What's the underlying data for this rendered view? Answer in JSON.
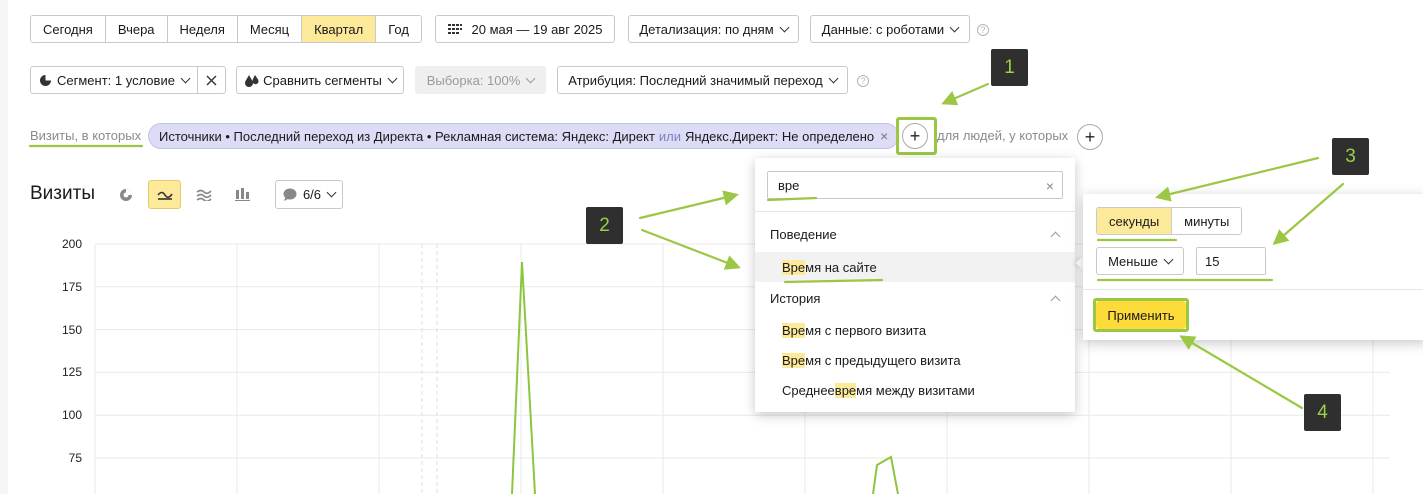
{
  "period": {
    "tabs": [
      {
        "label": "Сегодня",
        "active": false
      },
      {
        "label": "Вчера",
        "active": false
      },
      {
        "label": "Неделя",
        "active": false
      },
      {
        "label": "Месяц",
        "active": false
      },
      {
        "label": "Квартал",
        "active": true
      },
      {
        "label": "Год",
        "active": false
      }
    ],
    "date_range": "20 мая — 19 авг 2025"
  },
  "toolbar": {
    "detail_label": "Детализация: по дням",
    "data_label": "Данные: с роботами",
    "help_glyph": "?",
    "segment_label": "Сегмент: 1 условие",
    "compare_label": "Сравнить сегменты",
    "sample_label": "Выборка: 100%",
    "attribution_label": "Атрибуция: Последний значимый переход"
  },
  "filters": {
    "visits_label": "Визиты, в которых",
    "chip_part1": "Источники • Последний переход из Директа • Рекламная система: Яндекс: Директ",
    "chip_or": "или",
    "chip_part2": "Яндекс.Директ: Не определено",
    "people_label": "для людей, у которых",
    "plus_glyph": "+"
  },
  "chart": {
    "title": "Визиты",
    "series_selector": "6/6",
    "line_color": "#8cc63f"
  },
  "chart_data": {
    "type": "line",
    "y_ticks": [
      200,
      175,
      150,
      125,
      100,
      75
    ],
    "ylim": [
      75,
      200
    ],
    "title": "Визиты"
  },
  "dropdown": {
    "search_value": "вре",
    "groups": [
      {
        "label": "Поведение",
        "items": [
          {
            "match": "Вре",
            "rest": "мя на сайте",
            "prefix": ""
          }
        ]
      },
      {
        "label": "История",
        "items": [
          {
            "prefix": "",
            "match": "Вре",
            "rest": "мя с первого визита"
          },
          {
            "prefix": "",
            "match": "Вре",
            "rest": "мя с предыдущего визита"
          },
          {
            "prefix": "Среднее ",
            "match": "вре",
            "rest": "мя между визитами"
          }
        ]
      }
    ]
  },
  "condition_panel": {
    "units": [
      {
        "label": "секунды",
        "active": true
      },
      {
        "label": "минуты",
        "active": false
      }
    ],
    "operator": "Меньше",
    "value": "15",
    "apply_label": "Применить"
  },
  "annotations": {
    "badges": [
      "1",
      "2",
      "3",
      "4"
    ],
    "color": "#9bc745"
  }
}
